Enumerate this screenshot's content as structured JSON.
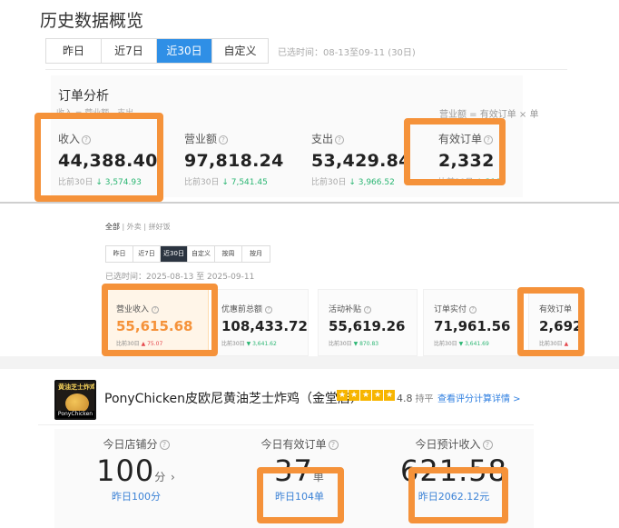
{
  "panel1": {
    "title": "历史数据概览",
    "tabs": [
      "昨日",
      "近7日",
      "近30日",
      "自定义"
    ],
    "active_tab": 2,
    "range_text": "已选时间：08-13至09-11 (30日)",
    "section_title": "订单分析",
    "subtitle": "收入 = 营业额 - 支出",
    "formula": "营业额 = 有效订单 × 单",
    "metrics": [
      {
        "label": "收入",
        "value": "44,388.40",
        "compare": "比前30日",
        "delta": "↓ 3,574.93"
      },
      {
        "label": "营业额",
        "value": "97,818.24",
        "compare": "比前30日",
        "delta": "↓ 7,541.45"
      },
      {
        "label": "支出",
        "value": "53,429.84",
        "compare": "比前30日",
        "delta": "↓ 3,966.52"
      },
      {
        "label": "有效订单",
        "value": "2,332",
        "compare": "比前30日",
        "delta": "↓ 210"
      }
    ]
  },
  "panel2": {
    "filter_all": "全部",
    "filter_waimai": "外卖",
    "filter_pin": "拼好饭",
    "tabs": [
      "昨日",
      "近7日",
      "近30日",
      "自定义",
      "按周",
      "按月"
    ],
    "active_tab": 2,
    "range_text": "已选时间：2025-08-13 至 2025-09-11",
    "metrics": [
      {
        "label": "营业收入",
        "value": "55,615.68",
        "compare": "比前30日",
        "delta": "▲ 75.07"
      },
      {
        "label": "优惠前总额",
        "value": "108,433.72",
        "compare": "比前30日",
        "delta": "▼ 3,641.62"
      },
      {
        "label": "活动补贴",
        "value": "55,619.26",
        "compare": "比前30日",
        "delta": "▼ 870.83"
      },
      {
        "label": "订单实付",
        "value": "71,961.56",
        "compare": "比前30日",
        "delta": "▼ 3,641.69"
      },
      {
        "label": "有效订单",
        "value": "2,692",
        "compare": "比前30日",
        "delta": "▲"
      }
    ]
  },
  "panel3": {
    "logo_tag": "黄油芝士炸鸡",
    "logo_bar": "PonyChicken",
    "shop_name": "PonyChicken皮欧尼黄油芝士炸鸡（金堂店）",
    "stars": [
      "★",
      "★",
      "★",
      "★",
      "★"
    ],
    "score": "4.8",
    "score_unit": "持平",
    "detail_link": "查看评分计算详情 >",
    "metrics": [
      {
        "label": "今日店铺分",
        "value": "100",
        "unit": "分 ›",
        "compare": "昨日100分"
      },
      {
        "label": "今日有效订单",
        "value": "37",
        "unit": "单",
        "compare": "昨日104单"
      },
      {
        "label": "今日预计收入",
        "value": "621.58",
        "unit": "",
        "compare": "昨日2062.12元"
      }
    ]
  },
  "colors": {
    "highlight": "#f5923a",
    "active_tab_blue": "#2f8fe6",
    "active_tab_dark": "#2b3440",
    "up_green": "#2bb673",
    "link_blue": "#2f7fe0"
  }
}
